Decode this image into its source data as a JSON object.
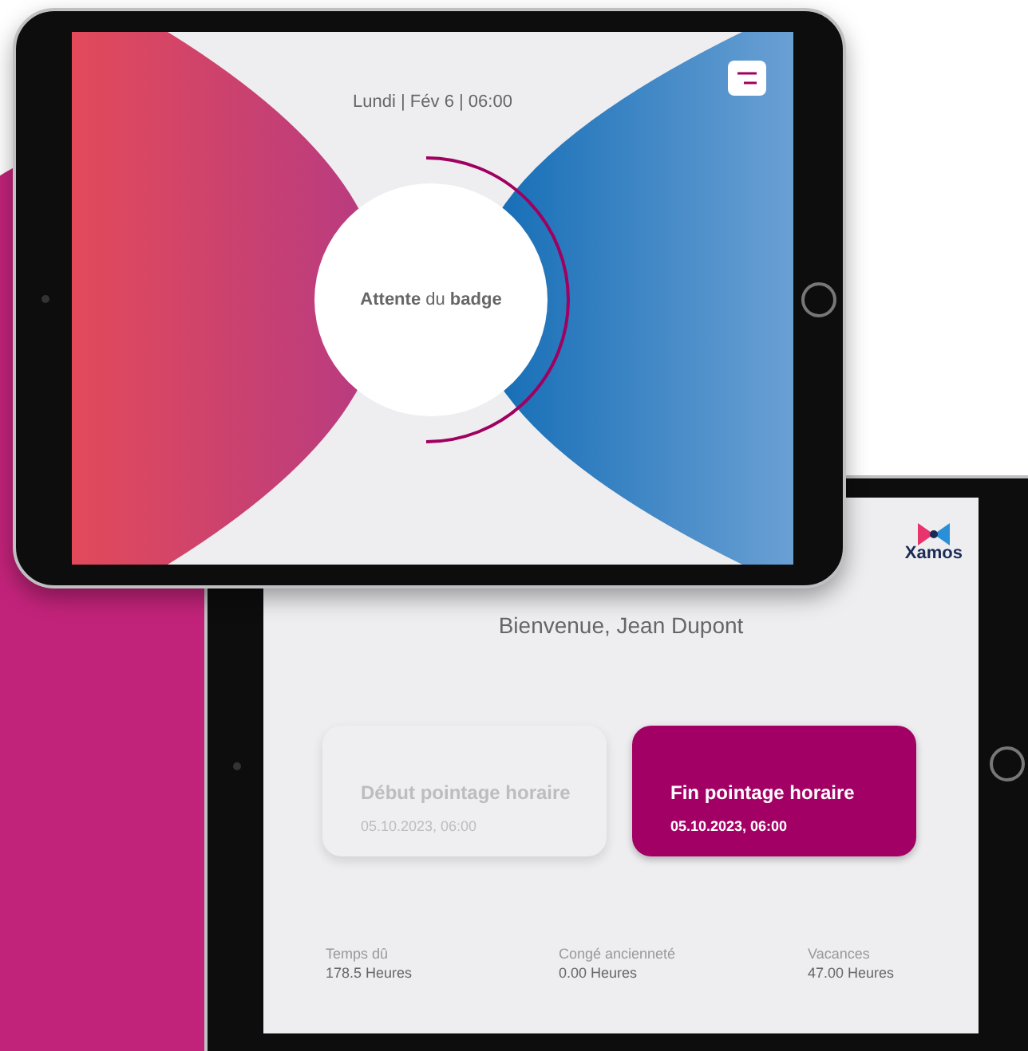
{
  "kiosk": {
    "date_time": "Lundi | Fév 6 | 06:00",
    "status": "**Attente** du **badge**"
  },
  "dashboard": {
    "brand": "Xamos",
    "greeting": "Bienvenue, Jean Dupont",
    "punch_buttons": [
      {
        "title": "Début pointage horaire",
        "time": "05.10.2023, 06:00",
        "selected": false
      },
      {
        "title": "Fin pointage horaire",
        "time": "05.10.2023, 06:00",
        "selected": true
      }
    ],
    "balances": [
      {
        "label": "Temps dû",
        "value": "178.5 Heures"
      },
      {
        "label": "Congé ancienneté",
        "value": "0.00 Heures"
      },
      {
        "label": "Vacances",
        "value": "47.00 Heures"
      }
    ]
  }
}
